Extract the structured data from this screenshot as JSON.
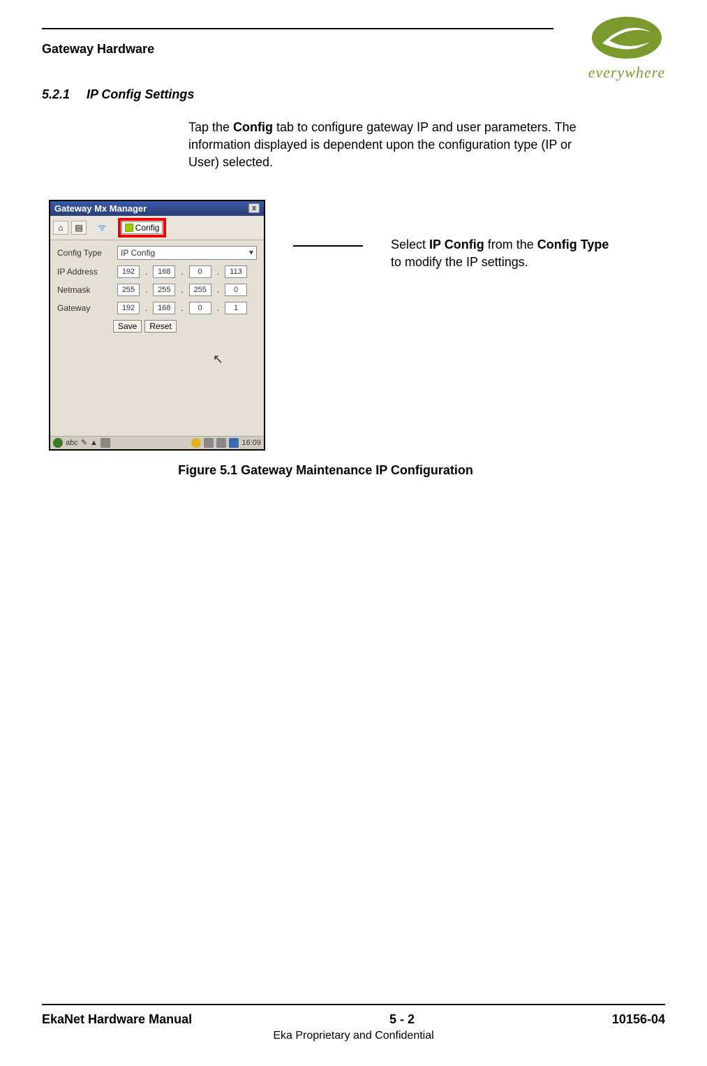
{
  "header": {
    "page_title": "Gateway Hardware",
    "logo_text": "everywhere"
  },
  "section": {
    "number": "5.2.1",
    "title": "IP Config Settings"
  },
  "body": {
    "para_prefix": "Tap the ",
    "para_bold1": "Config",
    "para_suffix": " tab to configure gateway IP and user parameters. The information displayed is dependent upon the configuration type (IP or User) selected."
  },
  "callout": {
    "t1": "Select ",
    "b1": "IP Config",
    "t2": " from the ",
    "b2": "Config Type",
    "t3": " to modify the IP settings."
  },
  "figure": {
    "caption": "Figure 5.1  Gateway Maintenance IP Configuration"
  },
  "app": {
    "title": "Gateway Mx Manager",
    "close": "x",
    "config_tab_label": "Config",
    "config_type_label": "Config Type",
    "config_type_value": "IP Config",
    "rows": {
      "ip_label": "IP Address",
      "ip": [
        "192",
        "168",
        "0",
        "113"
      ],
      "nm_label": "Netmask",
      "nm": [
        "255",
        "255",
        "255",
        "0"
      ],
      "gw_label": "Gateway",
      "gw": [
        "192",
        "168",
        "0",
        "1"
      ]
    },
    "save_label": "Save",
    "reset_label": "Reset",
    "taskbar": {
      "abc": "abc",
      "clock": "16:09"
    }
  },
  "footer": {
    "left": "EkaNet Hardware Manual",
    "center": "5 - 2",
    "right": "10156-04",
    "sub": "Eka Proprietary and Confidential"
  }
}
